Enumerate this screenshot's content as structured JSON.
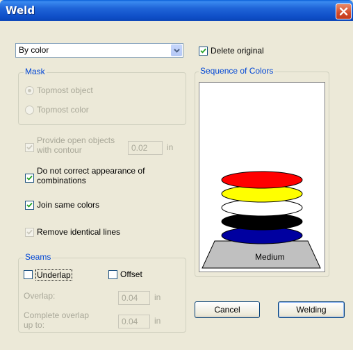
{
  "window": {
    "title": "Weld"
  },
  "mode_select": {
    "value": "By color"
  },
  "mask": {
    "label": "Mask",
    "options": [
      {
        "label": "Topmost object",
        "selected": true
      },
      {
        "label": "Topmost color",
        "selected": false
      }
    ]
  },
  "options": {
    "provide_open_line1": "Provide open objects",
    "provide_open_line2": "with contour",
    "provide_open_value": "0.02",
    "provide_open_unit": "in",
    "no_correct_line1": "Do not correct appearance of",
    "no_correct_line2": "combinations",
    "join_same_colors": "Join same colors",
    "remove_identical": "Remove identical lines"
  },
  "seams": {
    "label": "Seams",
    "underlap": "Underlap",
    "offset": "Offset",
    "overlap_label": "Overlap:",
    "overlap_value": "0.04",
    "overlap_unit": "in",
    "complete_line1": "Complete overlap",
    "complete_line2": "up to:",
    "complete_value": "0.04",
    "complete_unit": "in"
  },
  "delete_original": "Delete original",
  "sequence": {
    "label": "Sequence of Colors",
    "medium_label": "Medium",
    "colors": [
      "#0000a0",
      "#000000",
      "#ffffff",
      "#ffff00",
      "#ff0000"
    ]
  },
  "buttons": {
    "cancel": "Cancel",
    "welding": "Welding"
  }
}
